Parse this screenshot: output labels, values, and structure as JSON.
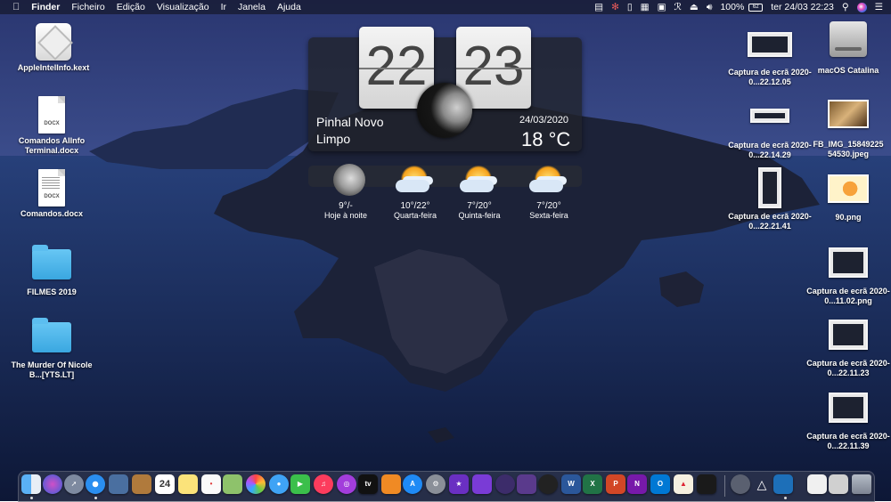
{
  "menubar": {
    "apple": "",
    "app_name": "Finder",
    "menus": [
      "Ficheiro",
      "Edição",
      "Visualização",
      "Ir",
      "Janela",
      "Ajuda"
    ],
    "battery_percent": "100%",
    "battery_glyph": "62",
    "datetime": "ter 24/03  22:23"
  },
  "desktop": {
    "left": [
      {
        "label": "AppleIntelInfo.kext",
        "icon": "kext-icon"
      },
      {
        "label": "Comandos AIInfo Terminal.docx",
        "icon": "docx-icon",
        "tag": "DOCX"
      },
      {
        "label": "Comandos.docx",
        "icon": "docx-icon",
        "tag": "DOCX"
      },
      {
        "label": "FILMES 2019",
        "icon": "folder-icon"
      },
      {
        "label": "The Murder Of Nicole B...[YTS.LT]",
        "icon": "folder-icon"
      }
    ],
    "right": [
      {
        "label": "Captura de ecrã 2020-0...22.12.05"
      },
      {
        "label": "macOS Catalina"
      },
      {
        "label": "Captura de ecrã 2020-0...22.14.29"
      },
      {
        "label": "FB_IMG_15849225 54530.jpeg"
      },
      {
        "label": "Captura de ecrã 2020-0...22.21.41"
      },
      {
        "label": "90.png"
      },
      {
        "label": "Captura de ecrã 2020-0...11.02.png"
      },
      {
        "label": "Captura de ecrã 2020-0...22.11.23"
      },
      {
        "label": "Captura de ecrã 2020-0...22.11.39"
      }
    ]
  },
  "clock_widget": {
    "hours": "22",
    "minutes": "23",
    "city": "Pinhal Novo",
    "condition": "Limpo",
    "date": "24/03/2020",
    "temperature": "18 °C"
  },
  "forecast": [
    {
      "temp": "9°/-",
      "day": "Hoje à noite",
      "icon": "moon-icon"
    },
    {
      "temp": "10°/22°",
      "day": "Quarta-feira",
      "icon": "sun-cloud-icon"
    },
    {
      "temp": "7°/20°",
      "day": "Quinta-feira",
      "icon": "sun-cloud-icon"
    },
    {
      "temp": "7°/20°",
      "day": "Sexta-feira",
      "icon": "sun-cloud-icon"
    }
  ],
  "dock": {
    "calendar_day": "24",
    "colors": {
      "finder": "#3a8ee6",
      "word": "#2b579a",
      "excel": "#217346",
      "powerpoint": "#d24726",
      "onenote": "#7719aa",
      "outlook": "#0078d4"
    }
  }
}
